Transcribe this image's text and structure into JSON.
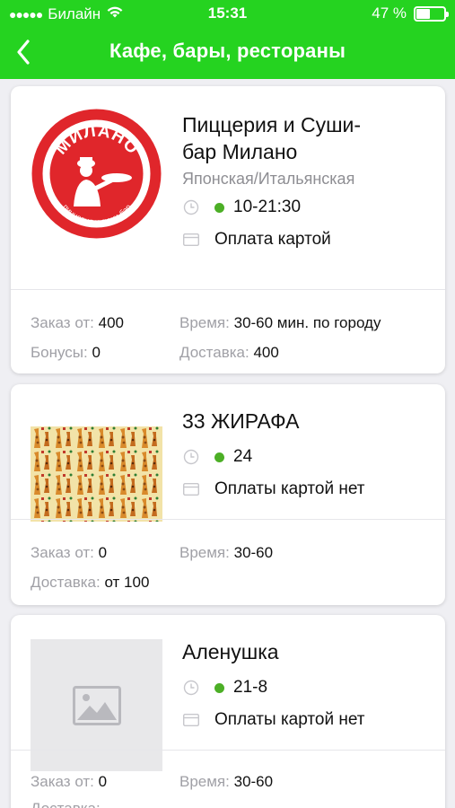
{
  "status_bar": {
    "carrier": "Билайн",
    "time": "15:31",
    "battery": "47 %"
  },
  "header": {
    "title": "Кафе, бары, рестораны"
  },
  "logo_milano": {
    "brand": "МИЛАНО",
    "tagline": "пиццерия и суши-бар"
  },
  "cards": [
    {
      "name_line1": "Пиццерия и Суши-",
      "name_line2": "бар Милано",
      "cuisine": "Японская/Итальянская",
      "hours": "10-21:30",
      "payment": "Оплата картой",
      "order_label": "Заказ от:",
      "order_value": "400",
      "bonus_label": "Бонусы:",
      "bonus_value": "0",
      "time_label": "Время:",
      "time_value": "30-60 мин. по городу",
      "delivery_label": "Доставка:",
      "delivery_value": "400"
    },
    {
      "name": "33 ЖИРАФА",
      "hours": "24",
      "payment": "Оплаты картой нет",
      "order_label": "Заказ от:",
      "order_value": "0",
      "time_label": "Время:",
      "time_value": "30-60",
      "delivery_label": "Доставка:",
      "delivery_value": "от 100"
    },
    {
      "name": "Аленушка",
      "hours": "21-8",
      "payment": "Оплаты картой нет",
      "order_label": "Заказ от:",
      "order_value": "0",
      "time_label": "Время:",
      "time_value": "30-60",
      "delivery_label": "Доставка:"
    }
  ],
  "colors": {
    "accent": "#25d320",
    "open_dot": "#4caf26",
    "logo_red": "#e0262b"
  },
  "icons": [
    "wifi-icon",
    "back-chevron-icon",
    "clock-icon",
    "card-icon",
    "image-placeholder-icon"
  ]
}
